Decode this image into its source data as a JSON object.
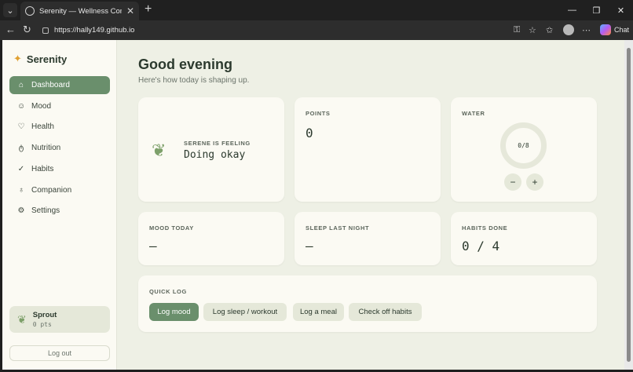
{
  "browser": {
    "tab_title": "Serenity — Wellness Companion",
    "url": "https://hally149.github.io",
    "chat_label": "Chat"
  },
  "sidebar": {
    "brand": "Serenity",
    "items": [
      {
        "label": "Dashboard",
        "icon": "home-icon"
      },
      {
        "label": "Mood",
        "icon": "smile-icon"
      },
      {
        "label": "Health",
        "icon": "heart-icon"
      },
      {
        "label": "Nutrition",
        "icon": "apple-icon"
      },
      {
        "label": "Habits",
        "icon": "check-circle-icon"
      },
      {
        "label": "Companion",
        "icon": "sprout-icon"
      },
      {
        "label": "Settings",
        "icon": "gear-icon"
      }
    ],
    "pet": {
      "name": "Sprout",
      "points": "0 pts"
    },
    "logout": "Log out"
  },
  "header": {
    "greeting": "Good evening",
    "subtitle": "Here's how today is shaping up."
  },
  "cards": {
    "serene": {
      "caption": "SERENE IS FEELING",
      "value": "Doing okay"
    },
    "points": {
      "label": "POINTS",
      "value": "0"
    },
    "water": {
      "label": "WATER",
      "value": "0/8",
      "minus": "−",
      "plus": "+"
    },
    "mood": {
      "label": "MOOD TODAY",
      "value": "—"
    },
    "sleep": {
      "label": "SLEEP LAST NIGHT",
      "value": "—"
    },
    "habits": {
      "label": "HABITS DONE",
      "value": "0 / 4"
    }
  },
  "quick_log": {
    "label": "QUICK LOG",
    "buttons": [
      "Log mood",
      "Log sleep / workout",
      "Log a meal",
      "Check off habits"
    ]
  },
  "colors": {
    "accent": "#6a8f6c",
    "background": "#eef0e5",
    "card": "#fbfaf3"
  }
}
